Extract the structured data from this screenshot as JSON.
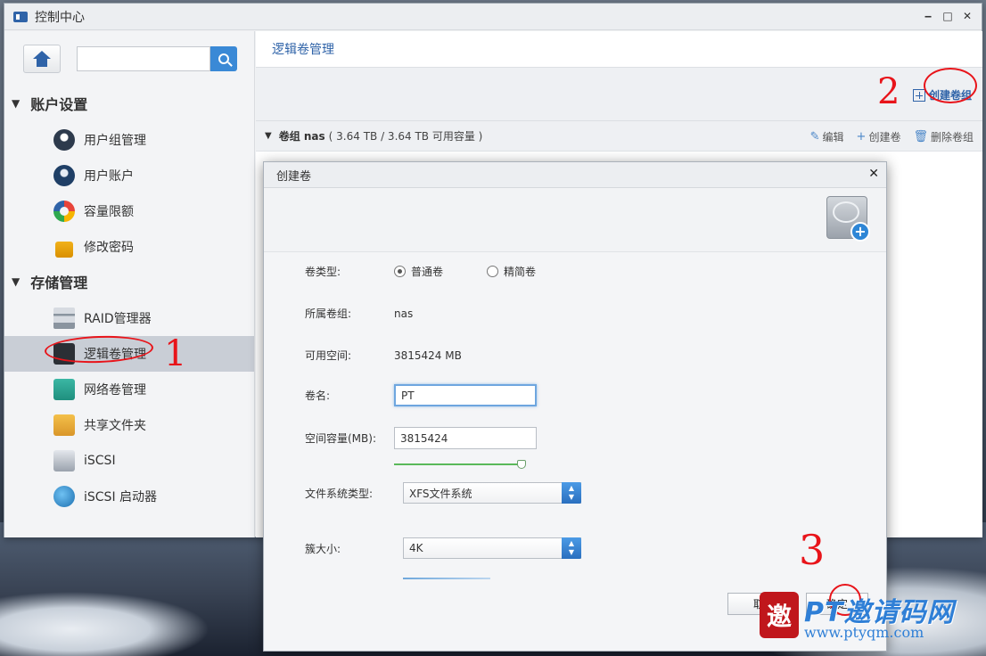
{
  "window": {
    "title": "控制中心",
    "controls": [
      "‒",
      "□",
      "✕"
    ]
  },
  "sidebar": {
    "search_placeholder": "",
    "sections": [
      {
        "label": "账户设置"
      },
      {
        "label": "存储管理"
      }
    ],
    "items": [
      {
        "label": "用户组管理",
        "icon": "user-group-icon"
      },
      {
        "label": "用户账户",
        "icon": "user-account-icon"
      },
      {
        "label": "容量限额",
        "icon": "quota-icon"
      },
      {
        "label": "修改密码",
        "icon": "lock-icon"
      },
      {
        "label": "RAID管理器",
        "icon": "raid-icon"
      },
      {
        "label": "逻辑卷管理",
        "icon": "lvm-icon",
        "active": true
      },
      {
        "label": "网络卷管理",
        "icon": "network-volume-icon"
      },
      {
        "label": "共享文件夹",
        "icon": "share-folder-icon"
      },
      {
        "label": "iSCSI",
        "icon": "iscsi-icon"
      },
      {
        "label": "iSCSI 启动器",
        "icon": "iscsi-initiator-icon"
      }
    ]
  },
  "main": {
    "header": "逻辑卷管理",
    "create_group": "创建卷组",
    "group": {
      "name": "卷组 nas",
      "info": "( 3.64 TB / 3.64 TB 可用容量 )",
      "actions": {
        "edit": "编辑",
        "create_volume": "创建卷",
        "delete_group": "删除卷组"
      }
    }
  },
  "dialog": {
    "title": "创建卷",
    "volume_type_label": "卷类型:",
    "type_normal": "普通卷",
    "type_thin": "精简卷",
    "group_label": "所属卷组:",
    "group_value": "nas",
    "free_label": "可用空间:",
    "free_value": "3815424 MB",
    "name_label": "卷名:",
    "name_value": "PT",
    "size_label": "空间容量(MB):",
    "size_value": "3815424",
    "size_slider_fraction": 1.0,
    "fs_label": "文件系统类型:",
    "fs_value": "XFS文件系统",
    "cluster_label": "簇大小:",
    "cluster_value": "4K",
    "cancel": "取",
    "ok": "确定"
  },
  "annotations": {
    "a1": "1",
    "a2": "2",
    "a3": "3"
  },
  "watermark": {
    "brand": "PT邀请码网",
    "url": "www.ptyqm.com"
  }
}
